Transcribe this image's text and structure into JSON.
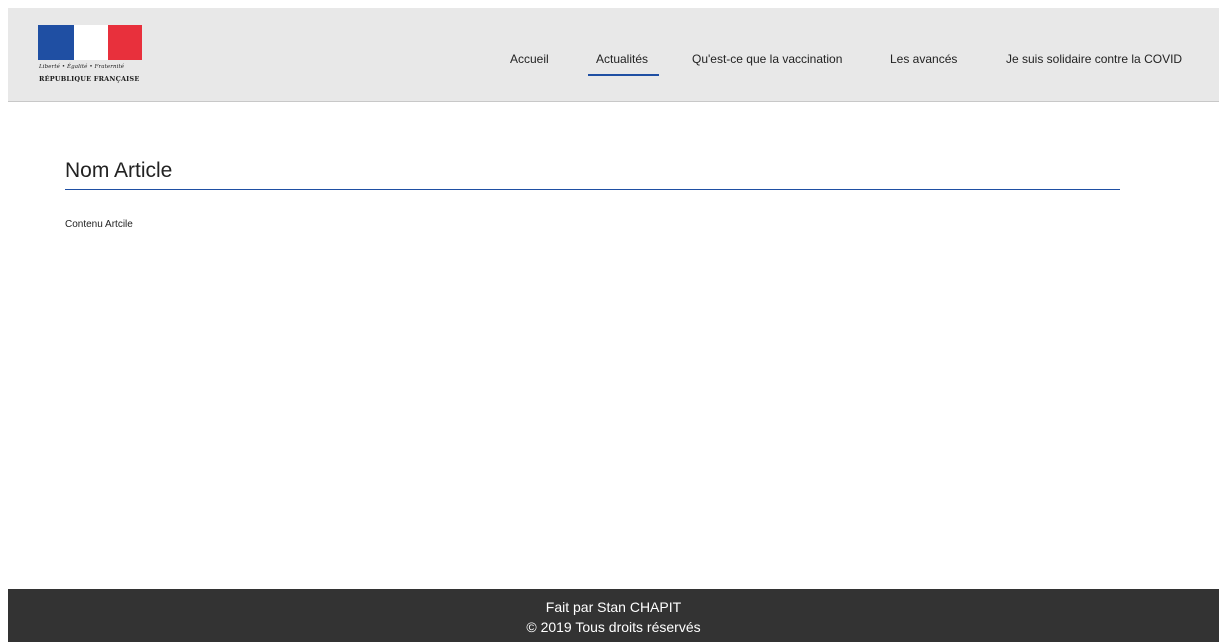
{
  "header": {
    "logo": {
      "motto": "Liberté • Égalité • Fraternité",
      "name": "RÉPUBLIQUE FRANÇAISE",
      "colors": {
        "blue": "#1f4fa3",
        "white": "#ffffff",
        "red": "#e8303c"
      }
    },
    "nav": [
      {
        "label": "Accueil",
        "active": false
      },
      {
        "label": "Actualités",
        "active": true
      },
      {
        "label": "Qu'est-ce que la vaccination",
        "active": false
      },
      {
        "label": "Les avancés",
        "active": false
      },
      {
        "label": "Je suis solidaire contre la COVID",
        "active": false
      }
    ],
    "accent_color": "#1f4fa3"
  },
  "article": {
    "title": "Nom Article",
    "content": "Contenu Artcile"
  },
  "footer": {
    "line1": "Fait par Stan CHAPIT",
    "line2": "© 2019 Tous droits réservés",
    "background": "#333333"
  }
}
